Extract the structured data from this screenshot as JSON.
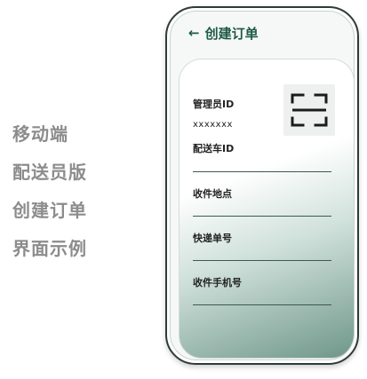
{
  "caption": {
    "lines": [
      "移动端",
      "配送员版",
      "创建订单",
      "界面示例"
    ]
  },
  "header": {
    "back_icon": "←",
    "title": "创建订单"
  },
  "form": {
    "admin_id_label": "管理员ID",
    "admin_id_value": "xxxxxxx",
    "courier_id_label": "配送车ID",
    "address_label": "收件地点",
    "tracking_label": "快递单号",
    "phone_label": "收件手机号"
  },
  "icons": {
    "back": "arrow-left-icon",
    "scan": "scan-icon"
  },
  "colors": {
    "accent": "#1f5a45",
    "caption": "#8c8c8c"
  }
}
